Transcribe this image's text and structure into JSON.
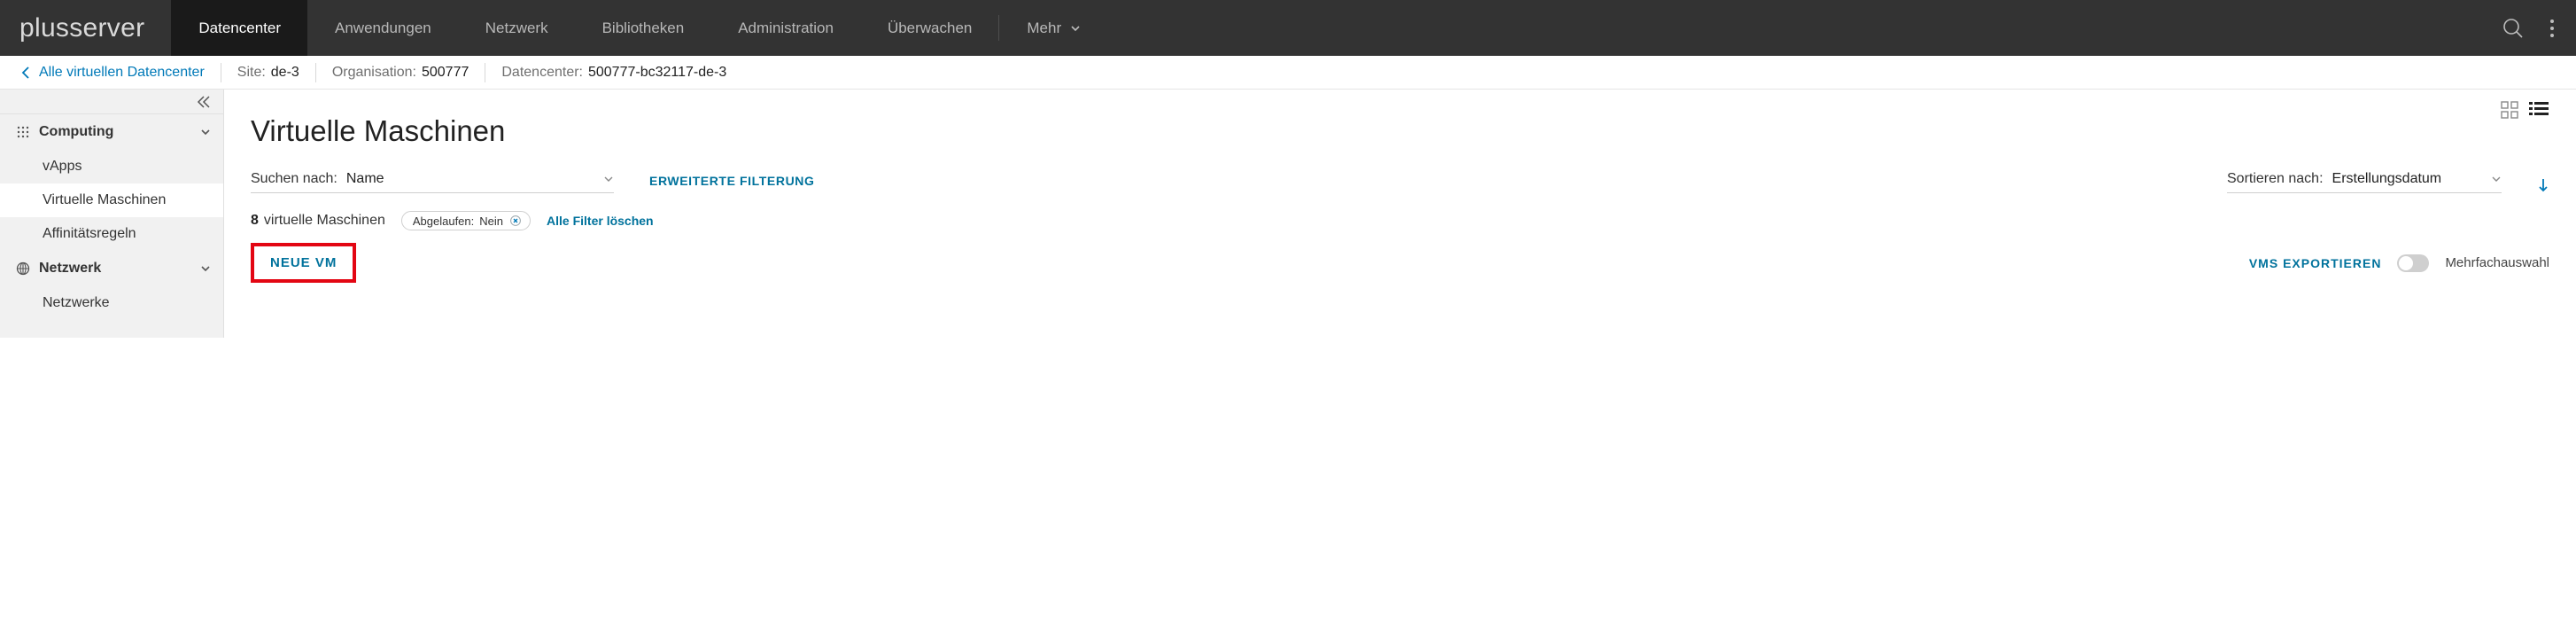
{
  "topnav": {
    "logo": "plusserver",
    "items": [
      {
        "label": "Datencenter",
        "active": true
      },
      {
        "label": "Anwendungen"
      },
      {
        "label": "Netzwerk"
      },
      {
        "label": "Bibliotheken"
      },
      {
        "label": "Administration"
      },
      {
        "label": "Überwachen"
      }
    ],
    "more_label": "Mehr"
  },
  "breadcrumb": {
    "back_label": "Alle virtuellen Datencenter",
    "site_label": "Site:",
    "site_value": "de-3",
    "org_label": "Organisation:",
    "org_value": "500777",
    "dc_label": "Datencenter:",
    "dc_value": "500777-bc32117-de-3"
  },
  "sidebar": {
    "sections": [
      {
        "title": "Computing",
        "items": [
          {
            "label": "vApps"
          },
          {
            "label": "Virtuelle Maschinen",
            "active": true
          },
          {
            "label": "Affinitätsregeln"
          }
        ]
      },
      {
        "title": "Netzwerk",
        "items": [
          {
            "label": "Netzwerke"
          }
        ]
      }
    ]
  },
  "page": {
    "title": "Virtuelle Maschinen",
    "search_by_label": "Suchen nach:",
    "search_by_value": "Name",
    "advanced_filter": "ERWEITERTE FILTERUNG",
    "sort_by_label": "Sortieren nach:",
    "sort_by_value": "Erstellungsdatum",
    "count": "8",
    "count_label": "virtuelle Maschinen",
    "filter_chip_label": "Abgelaufen:",
    "filter_chip_value": "Nein",
    "clear_filters": "Alle Filter löschen",
    "new_vm": "NEUE VM",
    "export_vms": "VMS EXPORTIEREN",
    "multi_select_label": "Mehrfachauswahl"
  }
}
